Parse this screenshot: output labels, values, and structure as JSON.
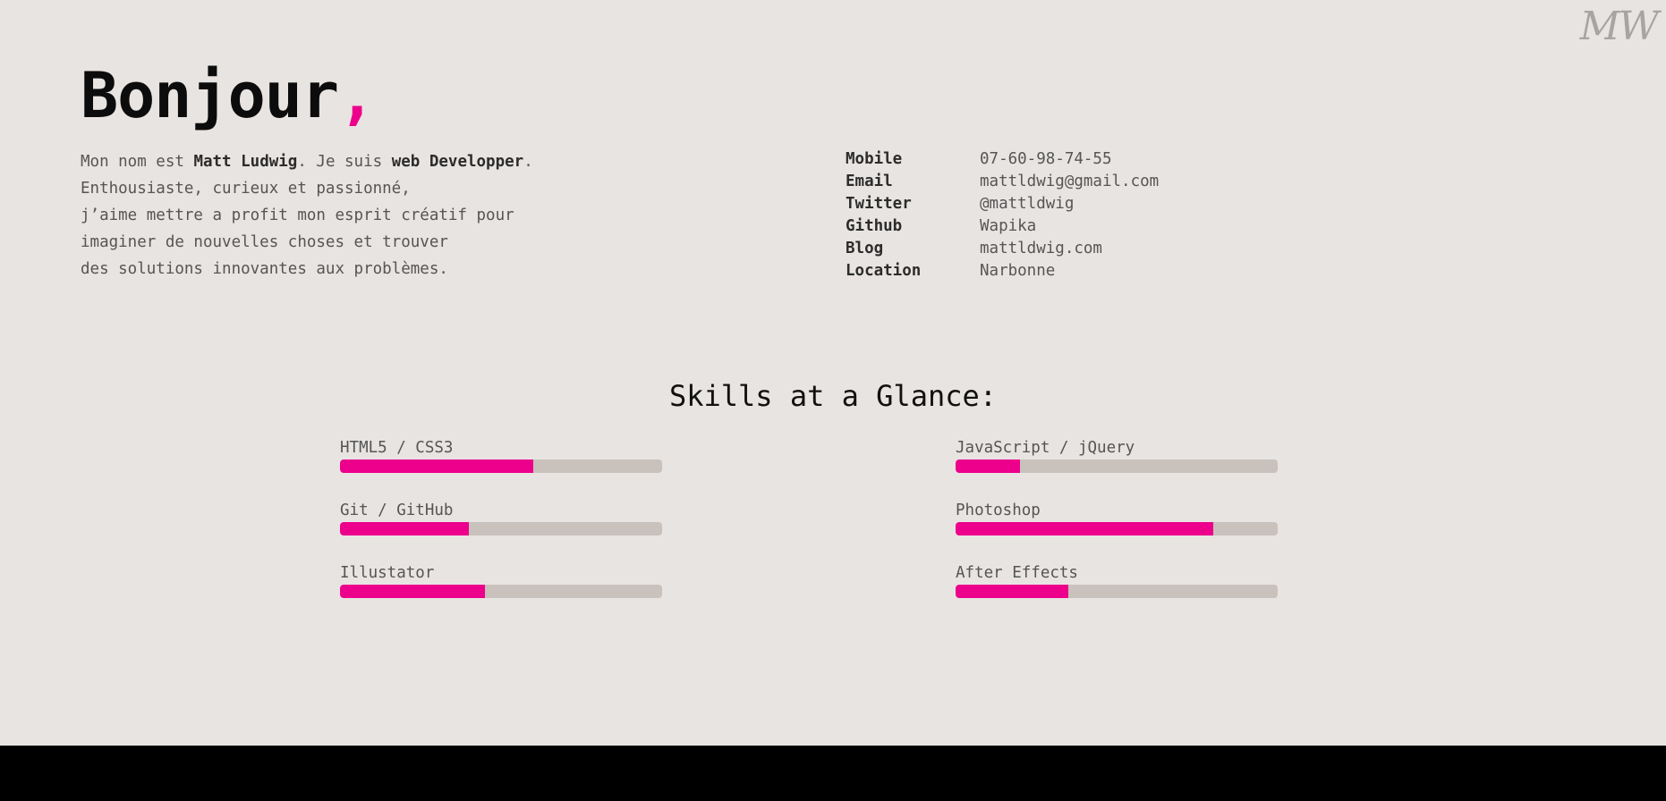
{
  "logo": "MW",
  "hero": {
    "greeting": "Bonjour",
    "comma": ","
  },
  "intro": {
    "line1_pre": "Mon nom est ",
    "name": "Matt Ludwig",
    "line1_mid": ". Je suis ",
    "role": "web Developper",
    "line1_post": ".",
    "line2": "Enthousiaste, curieux et passionné,",
    "line3": "j’aime mettre a profit mon esprit créatif pour",
    "line4": "imaginer de nouvelles choses et trouver",
    "line5": "des solutions innovantes aux problèmes."
  },
  "contact": [
    {
      "key": "Mobile",
      "value": "07-60-98-74-55"
    },
    {
      "key": "Email",
      "value": "mattldwig@gmail.com"
    },
    {
      "key": "Twitter",
      "value": "@mattldwig"
    },
    {
      "key": "Github",
      "value": "Wapika"
    },
    {
      "key": "Blog",
      "value": "mattldwig.com"
    },
    {
      "key": "Location",
      "value": "Narbonne"
    }
  ],
  "skills_title": "Skills at a Glance:",
  "skills": [
    {
      "label": "HTML5 / CSS3",
      "level": 0.6
    },
    {
      "label": "JavaScript / jQuery",
      "level": 0.2
    },
    {
      "label": "Git / GitHub",
      "level": 0.4
    },
    {
      "label": "Photoshop",
      "level": 0.8
    },
    {
      "label": "Illustator",
      "level": 0.45
    },
    {
      "label": "After Effects",
      "level": 0.35
    }
  ],
  "colors": {
    "accent": "#ec008c",
    "background": "#e8e4e1",
    "track": "#c9c1bc",
    "footer": "#000000"
  }
}
